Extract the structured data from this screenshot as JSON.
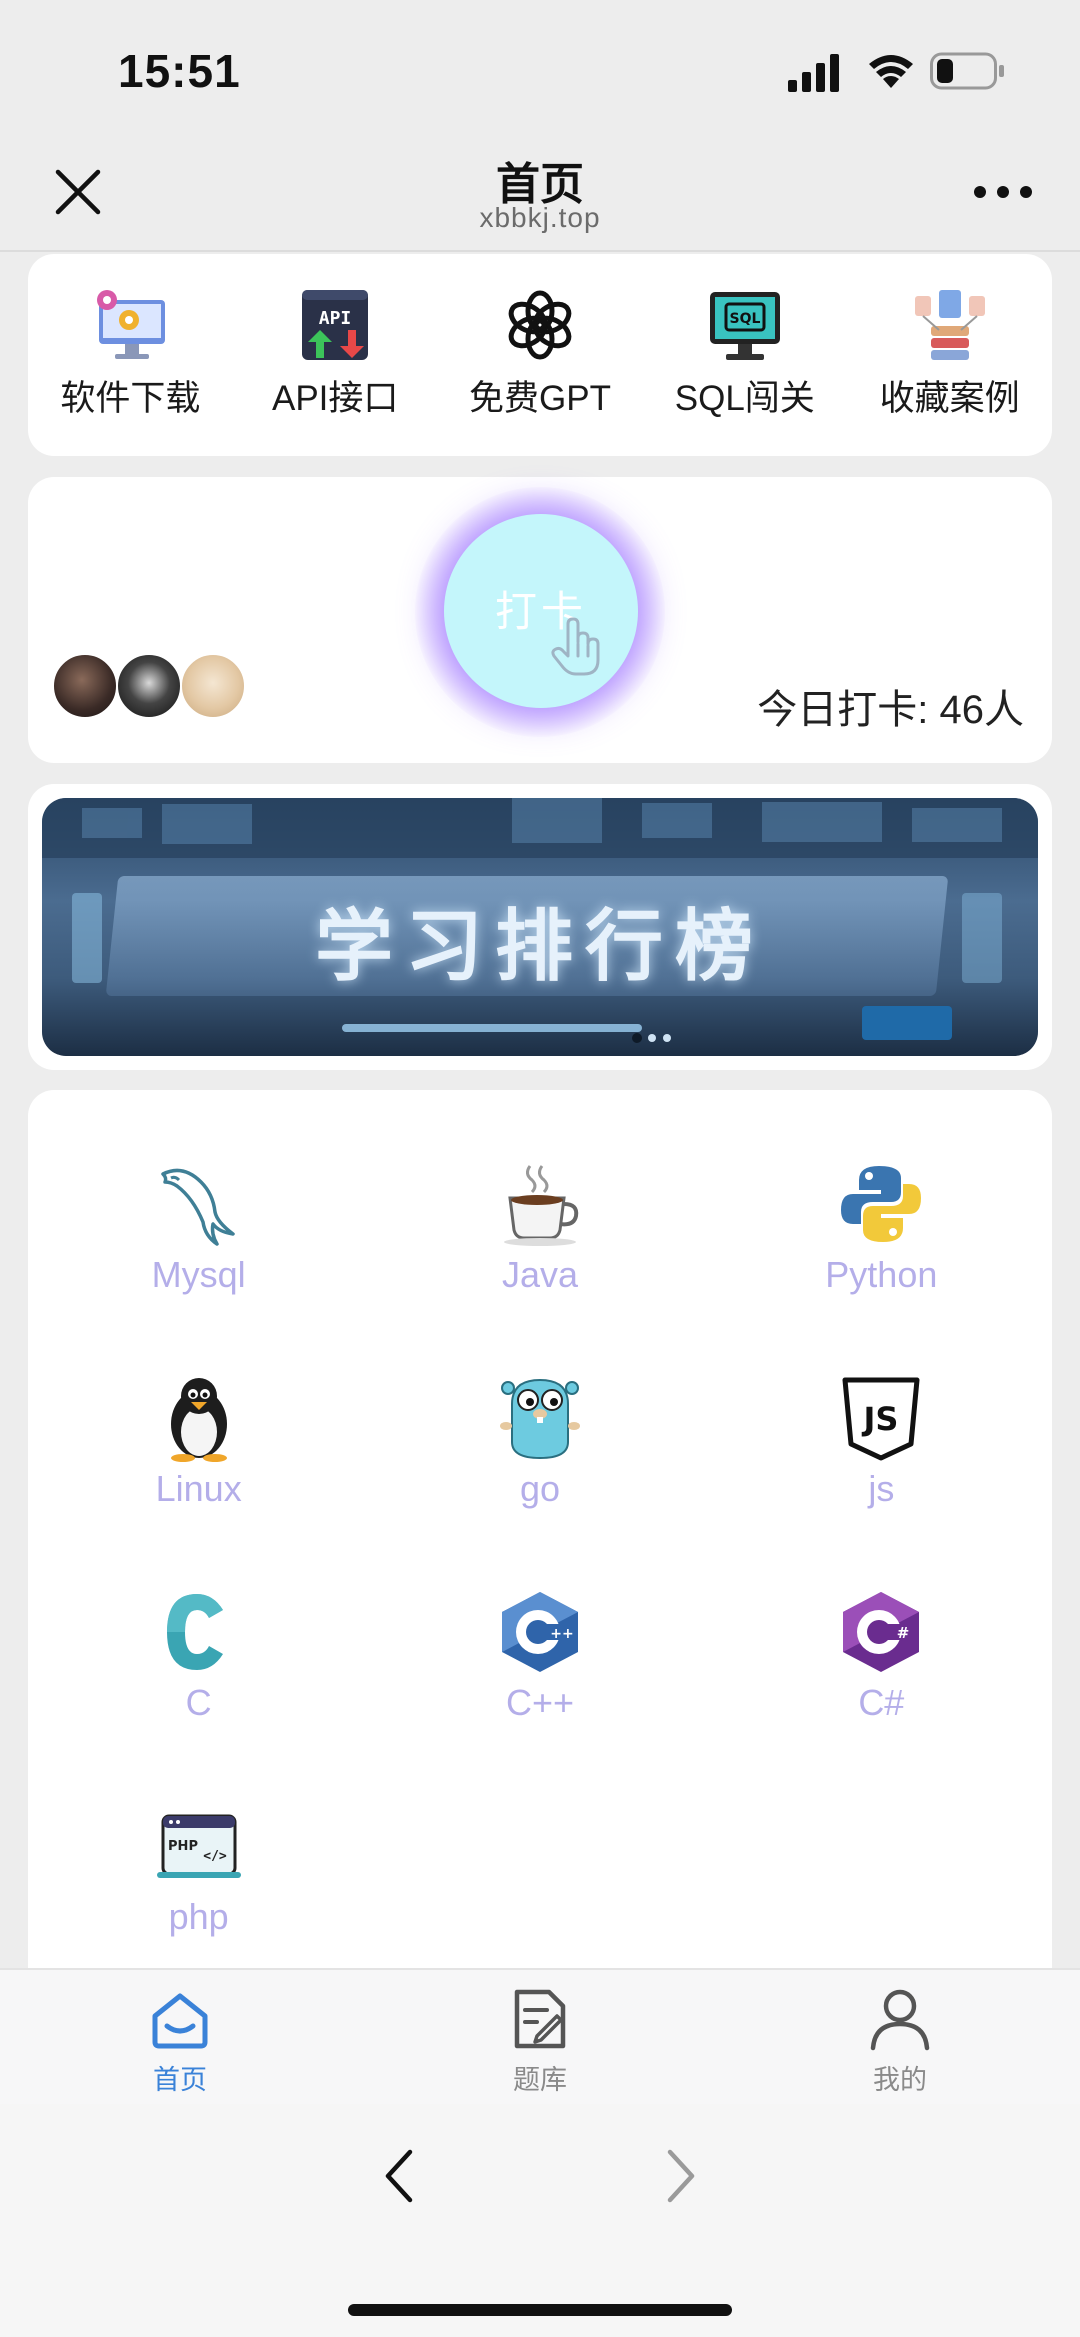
{
  "status_bar": {
    "time": "15:51"
  },
  "nav": {
    "title": "首页",
    "subtitle": "xbbkj.top"
  },
  "quick_links": [
    {
      "label": "软件下载",
      "icon": "software-download-icon"
    },
    {
      "label": "API接口",
      "icon": "api-icon"
    },
    {
      "label": "免费GPT",
      "icon": "openai-icon"
    },
    {
      "label": "SQL闯关",
      "icon": "sql-monitor-icon"
    },
    {
      "label": "收藏案例",
      "icon": "collection-icon"
    }
  ],
  "checkin": {
    "button_label": "打卡",
    "count_text": "今日打卡: 46人"
  },
  "banner": {
    "text": "学习排行榜"
  },
  "languages": [
    {
      "label": "Mysql",
      "icon": "mysql-dolphin-icon"
    },
    {
      "label": "Java",
      "icon": "java-cup-icon"
    },
    {
      "label": "Python",
      "icon": "python-icon"
    },
    {
      "label": "Linux",
      "icon": "linux-penguin-icon"
    },
    {
      "label": "go",
      "icon": "go-gopher-icon"
    },
    {
      "label": "js",
      "icon": "js-shield-icon"
    },
    {
      "label": "C",
      "icon": "c-icon"
    },
    {
      "label": "C++",
      "icon": "cpp-icon"
    },
    {
      "label": "C#",
      "icon": "csharp-icon"
    },
    {
      "label": "php",
      "icon": "php-window-icon"
    }
  ],
  "tabs": [
    {
      "label": "首页",
      "icon": "home-icon",
      "active": true
    },
    {
      "label": "题库",
      "icon": "question-bank-icon",
      "active": false
    },
    {
      "label": "我的",
      "icon": "profile-icon",
      "active": false
    }
  ],
  "colors": {
    "accent": "#3a82d8",
    "lang_label": "#b4aee9",
    "checkin_button": "#c4f6fb"
  }
}
